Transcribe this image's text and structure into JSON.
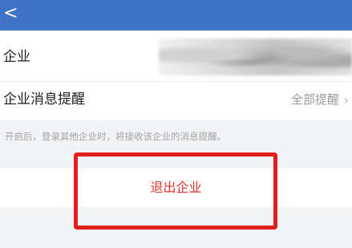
{
  "header": {
    "back_icon": "chevron-left-icon",
    "back_glyph": "<"
  },
  "settings": {
    "company_label": "企业",
    "notify_label": "企业消息提醒",
    "notify_value": "全部提醒",
    "notify_chevron": "›"
  },
  "hint": "开启后，登录其他企业时，将接收该企业的消息提醒。",
  "actions": {
    "exit_label": "退出企业"
  },
  "colors": {
    "header": "#3f73c6",
    "danger": "#e0342c",
    "highlight": "#e11f1f"
  }
}
